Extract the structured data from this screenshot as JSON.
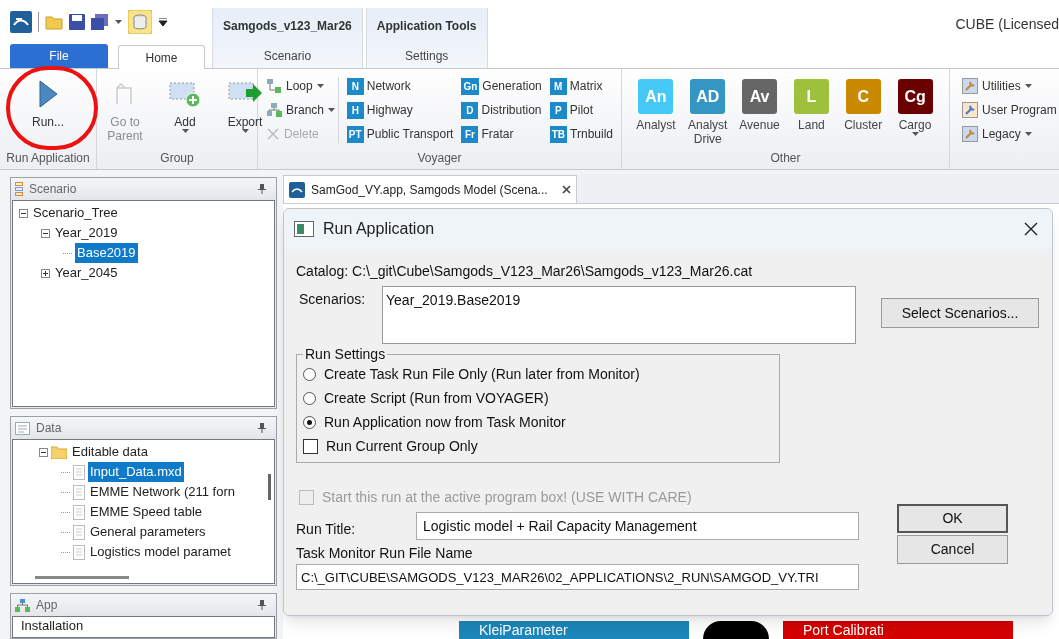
{
  "app_title": "CUBE (Licensed",
  "tabs": [
    {
      "label": "File",
      "kind": "file",
      "selected": false
    },
    {
      "label": "Home",
      "kind": "tab",
      "selected": true
    }
  ],
  "contextual_tabs": [
    {
      "group": "Samgods_v123_Mar26",
      "label": "Scenario",
      "selected": false
    },
    {
      "group": "Application Tools",
      "label": "Settings",
      "selected": false
    }
  ],
  "ribbon": {
    "run_group": {
      "label": "Run Application",
      "items": [
        {
          "label": "Run...",
          "disabled": false,
          "dropdown": false
        }
      ]
    },
    "group_group": {
      "label": "Group",
      "items": [
        {
          "label": "Go to Parent",
          "disabled": true,
          "dropdown": false
        },
        {
          "label": "Add",
          "disabled": false,
          "dropdown": true
        },
        {
          "label": "Export",
          "disabled": false,
          "dropdown": true
        }
      ]
    },
    "voyager": {
      "label": "Voyager",
      "commands": [
        {
          "label": "Loop",
          "disabled": false,
          "dropdown": true
        },
        {
          "label": "Branch",
          "disabled": false,
          "dropdown": true
        },
        {
          "label": "Delete",
          "disabled": true,
          "dropdown": false
        }
      ],
      "programs": [
        {
          "badge": "N",
          "label": "Network"
        },
        {
          "badge": "H",
          "label": "Highway"
        },
        {
          "badge": "PT",
          "label": "Public Transport"
        },
        {
          "badge": "Gn",
          "label": "Generation"
        },
        {
          "badge": "D",
          "label": "Distribution"
        },
        {
          "badge": "Fr",
          "label": "Fratar"
        },
        {
          "badge": "M",
          "label": "Matrix"
        },
        {
          "badge": "P",
          "label": "Pilot"
        },
        {
          "badge": "TB",
          "label": "Trnbuild"
        }
      ]
    },
    "other": {
      "label": "Other",
      "apps": [
        {
          "badge": "An",
          "label": "Analyst",
          "color": "#45c8f5",
          "dropdown": false
        },
        {
          "badge": "AD",
          "label": "Analyst Drive",
          "color": "#3496c2",
          "dropdown": false
        },
        {
          "badge": "Av",
          "label": "Avenue",
          "color": "#666666",
          "dropdown": false
        },
        {
          "badge": "L",
          "label": "Land",
          "color": "#9ec03c",
          "dropdown": false
        },
        {
          "badge": "C",
          "label": "Cluster",
          "color": "#c98a00",
          "dropdown": false
        },
        {
          "badge": "Cg",
          "label": "Cargo",
          "color": "#6b0000",
          "dropdown": true
        }
      ]
    },
    "tools": [
      {
        "label": "Utilities",
        "dropdown": true
      },
      {
        "label": "User Program",
        "dropdown": false
      },
      {
        "label": "Legacy",
        "dropdown": true
      }
    ]
  },
  "scenario_panel": {
    "title": "Scenario",
    "tree": [
      {
        "label": "Scenario_Tree",
        "expanded": true,
        "selected": false,
        "children": [
          {
            "label": "Year_2019",
            "expanded": true,
            "selected": false,
            "children": [
              {
                "label": "Base2019",
                "selected": true
              }
            ]
          },
          {
            "label": "Year_2045",
            "expanded": false,
            "selected": false
          }
        ]
      }
    ]
  },
  "data_panel": {
    "title": "Data",
    "tree": [
      {
        "label": "Editable data",
        "kind": "folder",
        "expanded": true,
        "selected": false,
        "children": [
          {
            "label": "Input_Data.mxd",
            "kind": "file",
            "selected": true
          },
          {
            "label": "EMME Network (211 forn",
            "kind": "file",
            "selected": false
          },
          {
            "label": "EMME Speed table",
            "kind": "file",
            "selected": false
          },
          {
            "label": "General parameters",
            "kind": "file",
            "selected": false
          },
          {
            "label": "Logistics model paramet",
            "kind": "file",
            "selected": false
          }
        ]
      }
    ]
  },
  "app_panel": {
    "title": "App",
    "items": [
      "Installation"
    ]
  },
  "document_tab": {
    "label": "SamGod_VY.app, Samgods Model (Scena...",
    "selected": true
  },
  "canvas_nodes": [
    {
      "label": "KleiParameter",
      "color": "#1b86b8",
      "kind": "box"
    },
    {
      "kind": "circle",
      "color": "#000000"
    },
    {
      "label": "Port Calibrati",
      "color": "#d40000",
      "kind": "box"
    }
  ],
  "dialog": {
    "title": "Run Application",
    "catalog": "Catalog: C:\\_git\\Cube\\Samgods_V123_Mar26\\Samgods_v123_Mar26.cat",
    "scenarios_label": "Scenarios:",
    "scenarios_value": "Year_2019.Base2019",
    "select_button": "Select Scenarios...",
    "run_settings": {
      "legend": "Run Settings",
      "options": [
        {
          "label": "Create Task Run File Only (Run later from Monitor)",
          "selected": false
        },
        {
          "label": "Create Script (Run from VOYAGER)",
          "selected": false
        },
        {
          "label": "Run Application now from Task Monitor",
          "selected": true
        }
      ],
      "group_only": {
        "label": "Run Current Group Only",
        "checked": false
      }
    },
    "start_active": {
      "label": "Start this run at the active program box! (USE WITH CARE)",
      "checked": false,
      "disabled": true
    },
    "run_title_label": "Run Title:",
    "run_title_value": "Logistic model + Rail Capacity Management",
    "file_label": "Task Monitor Run File Name",
    "file_value": "C:\\_GIT\\CUBE\\SAMGODS_V123_MAR26\\02_APPLICATIONS\\2_RUN\\SAMGOD_VY.TRI",
    "buttons": [
      "OK",
      "Cancel"
    ]
  }
}
